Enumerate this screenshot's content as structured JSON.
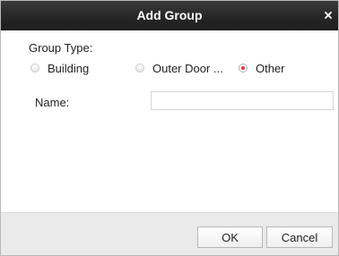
{
  "dialog": {
    "title": "Add Group",
    "close_icon": "close-icon"
  },
  "group_type": {
    "label": "Group Type:",
    "options": [
      {
        "label": "Building",
        "checked": false
      },
      {
        "label": "Outer Door ...",
        "checked": false
      },
      {
        "label": "Other",
        "checked": true
      }
    ]
  },
  "name_field": {
    "label": "Name:",
    "value": "",
    "placeholder": ""
  },
  "buttons": {
    "ok_label": "OK",
    "cancel_label": "Cancel"
  },
  "colors": {
    "titlebar": "#262626",
    "radio_selected": "#e0303a",
    "footer": "#eaeaea"
  }
}
